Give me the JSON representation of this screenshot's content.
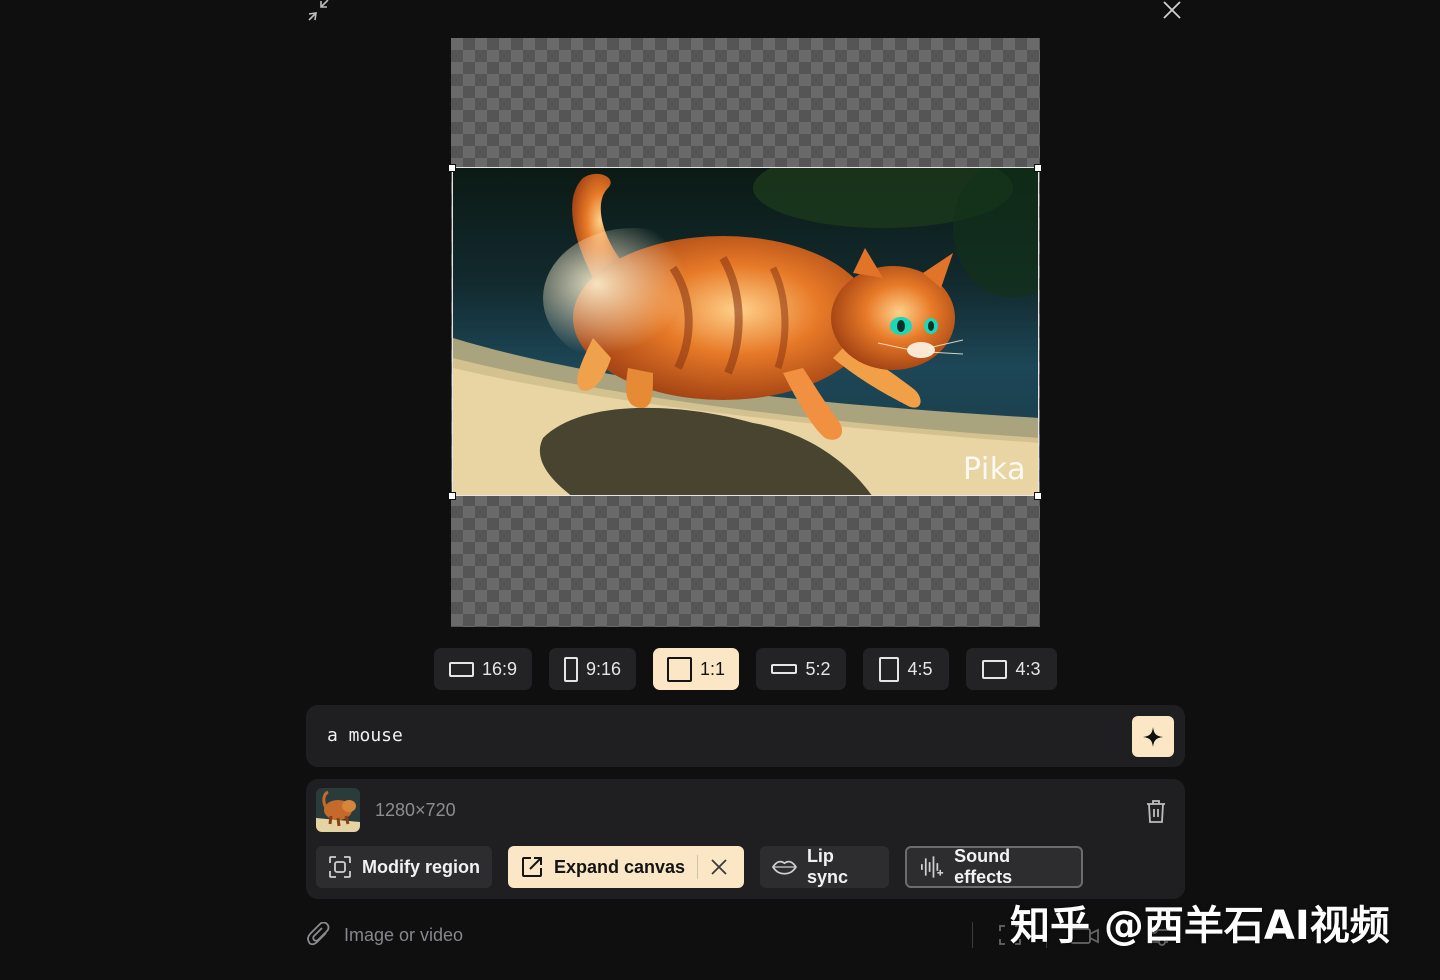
{
  "window": {
    "collapse_icon": "collapse-arrows-icon",
    "close_icon": "close-icon"
  },
  "canvas": {
    "watermark": "Pika",
    "image_subject": "orange kitten walking in sunlight"
  },
  "aspect_ratios": [
    {
      "label": "16:9",
      "icon": "landscape-rect-icon",
      "active": false
    },
    {
      "label": "9:16",
      "icon": "portrait-rect-icon",
      "active": false
    },
    {
      "label": "1:1",
      "icon": "square-icon",
      "active": true
    },
    {
      "label": "5:2",
      "icon": "wide-rect-icon",
      "active": false
    },
    {
      "label": "4:5",
      "icon": "portrait-rect-icon",
      "active": false
    },
    {
      "label": "4:3",
      "icon": "landscape-rect-icon",
      "active": false
    }
  ],
  "prompt": {
    "value": "a mouse",
    "generate_icon": "sparkle-icon"
  },
  "media": {
    "dimensions": "1280×720",
    "delete_icon": "trash-icon"
  },
  "tools": [
    {
      "label": "Modify region",
      "icon": "region-select-icon",
      "active": false
    },
    {
      "label": "Expand canvas",
      "icon": "expand-out-icon",
      "active": true
    },
    {
      "label": "Lip sync",
      "icon": "lips-icon",
      "active": false
    },
    {
      "label": "Sound effects",
      "icon": "waveform-icon",
      "active": false
    }
  ],
  "footer": {
    "attach_placeholder": "Image or video",
    "attach_icon": "paperclip-icon"
  },
  "overlay_watermark": "知乎 @西羊石AI视频",
  "colors": {
    "accent": "#fbe7c6",
    "background": "#0f0f10",
    "panel": "#1f1f21"
  }
}
